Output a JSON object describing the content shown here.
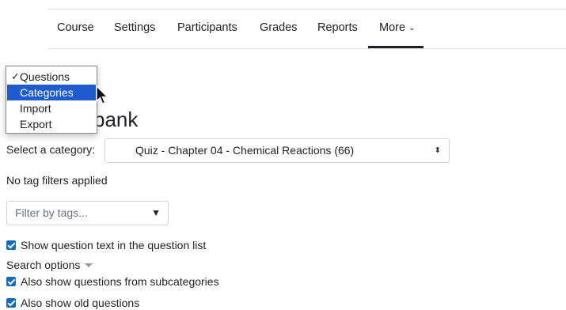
{
  "nav": {
    "items": [
      "Course",
      "Settings",
      "Participants",
      "Grades",
      "Reports"
    ],
    "more_label": "More"
  },
  "menu": {
    "items": [
      {
        "label": "Questions",
        "checked": true
      },
      {
        "label": "Categories",
        "selected": true
      },
      {
        "label": "Import"
      },
      {
        "label": "Export"
      }
    ]
  },
  "page": {
    "heading_visible": "bank"
  },
  "category": {
    "label": "Select a category:",
    "value": "Quiz - Chapter 04 - Chemical Reactions (66)"
  },
  "tags": {
    "status": "No tag filters applied",
    "placeholder": "Filter by tags..."
  },
  "options": {
    "show_text": "Show question text in the question list",
    "search_options": "Search options",
    "subcategories": "Also show questions from subcategories",
    "old_questions": "Also show old questions"
  },
  "colors": {
    "accent": "#0f6cbf",
    "menu_highlight": "#1e5bd0"
  }
}
